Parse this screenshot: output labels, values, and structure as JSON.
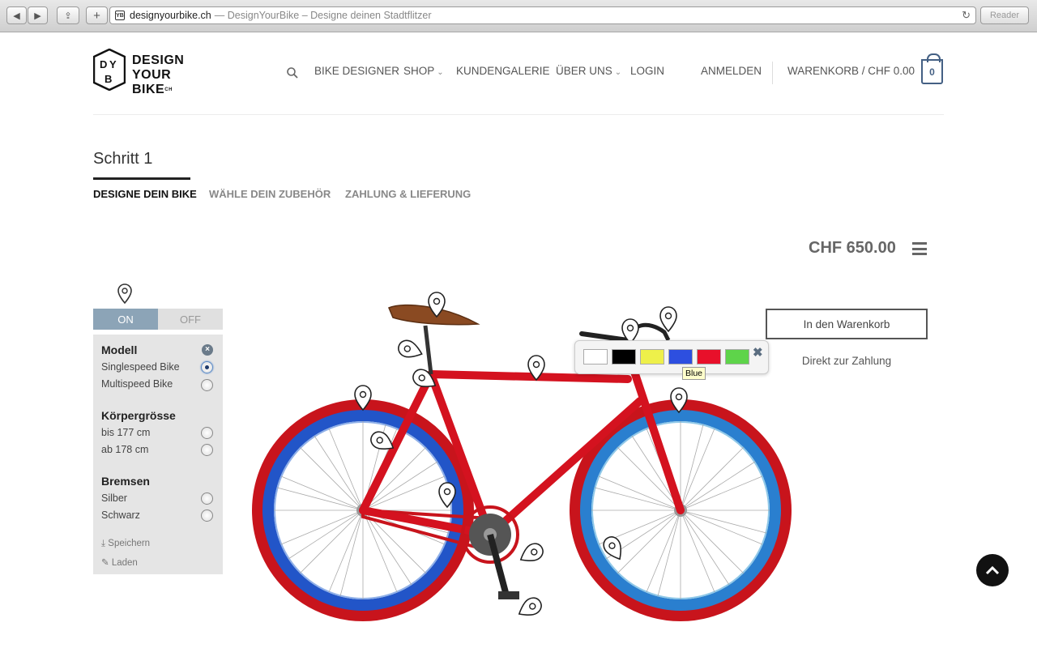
{
  "browser": {
    "domain": "designyourbike.ch",
    "title": "— DesignYourBike – Designe deinen Stadtflitzer",
    "reader_label": "Reader"
  },
  "logo": {
    "line1": "DESIGN",
    "line2": "YOUR BIKE",
    "suffix": "CH",
    "mark": "DYB"
  },
  "nav": {
    "bike_designer": "BIKE DESIGNER",
    "shop": "SHOP",
    "gallery": "KUNDENGALERIE",
    "about": "ÜBER UNS",
    "login": "LOGIN",
    "register": "ANMELDEN",
    "cart": "WARENKORB / CHF 0.00",
    "cart_count": "0"
  },
  "steps": {
    "title": "Schritt 1",
    "tabs": [
      "DESIGNE DEIN BIKE",
      "WÄHLE DEIN ZUBEHÖR",
      "ZAHLUNG & LIEFERUNG"
    ]
  },
  "price": "CHF 650.00",
  "toggle": {
    "on": "ON",
    "off": "OFF"
  },
  "config": {
    "model_title": "Modell",
    "model_opts": [
      "Singlespeed Bike",
      "Multispeed Bike"
    ],
    "size_title": "Körpergrösse",
    "size_opts": [
      "bis 177 cm",
      "ab 178 cm"
    ],
    "brakes_title": "Bremsen",
    "brakes_opts": [
      "Silber",
      "Schwarz"
    ],
    "save": "Speichern",
    "load": "Laden"
  },
  "picker": {
    "colors": [
      "#ffffff",
      "#000000",
      "#eef04a",
      "#2d4fe0",
      "#e8102a",
      "#5ed44a"
    ],
    "tooltip": "Blue"
  },
  "buttons": {
    "add_to_cart": "In den Warenkorb",
    "direct_pay": "Direkt zur Zahlung"
  },
  "bike_colors": {
    "frame": "#d4121f",
    "rim": "#2255c8",
    "tire": "#c8141c",
    "saddle": "#8a4a22"
  }
}
